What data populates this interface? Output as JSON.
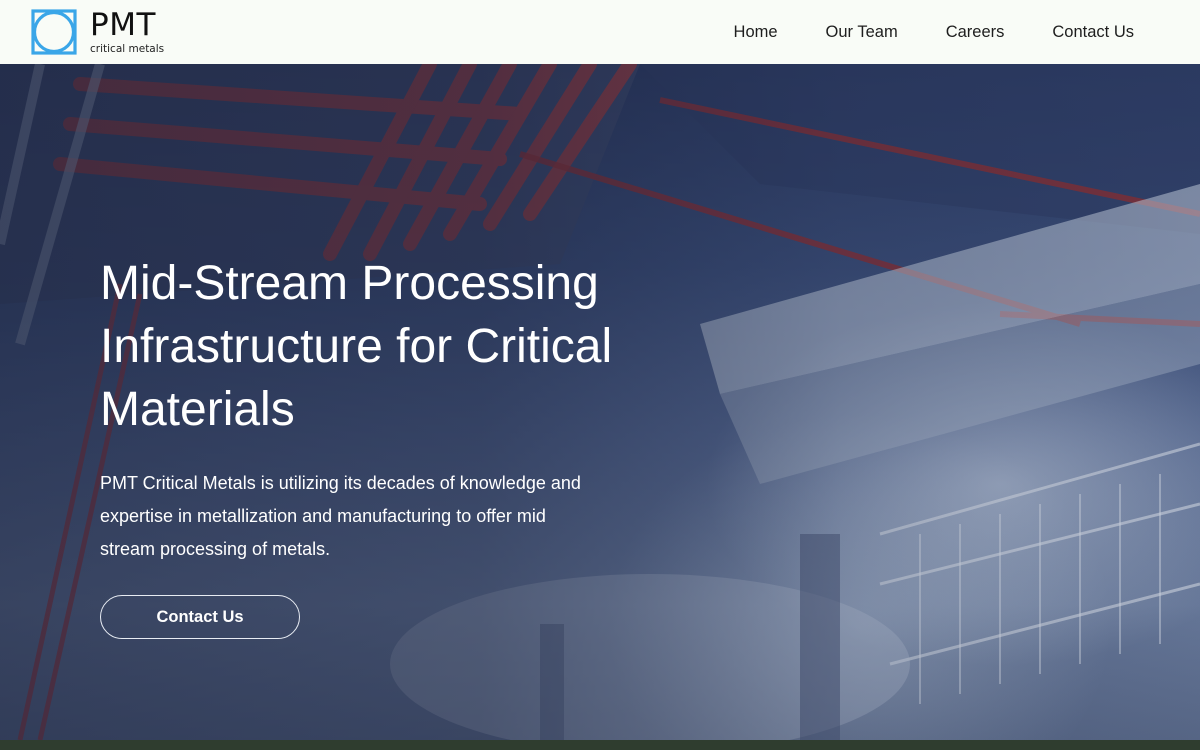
{
  "brand": {
    "name": "PMT",
    "tagline": "critical metals",
    "logo_icon": "square-circle-logo-icon",
    "logo_color": "#3aa6e8"
  },
  "nav": {
    "items": [
      {
        "label": "Home"
      },
      {
        "label": "Our Team"
      },
      {
        "label": "Careers"
      },
      {
        "label": "Contact Us"
      }
    ]
  },
  "hero": {
    "title": "Mid-Stream Processing Infrastructure for Critical Materials",
    "description": "PMT Critical Metals is utilizing its decades of knowledge and expertise in metallization and manufacturing to offer mid stream processing of metals.",
    "cta_label": "Contact Us"
  },
  "colors": {
    "header_bg": "#f9fcf7",
    "hero_text": "#ffffff",
    "footer_strip": "#2f3d2f"
  }
}
